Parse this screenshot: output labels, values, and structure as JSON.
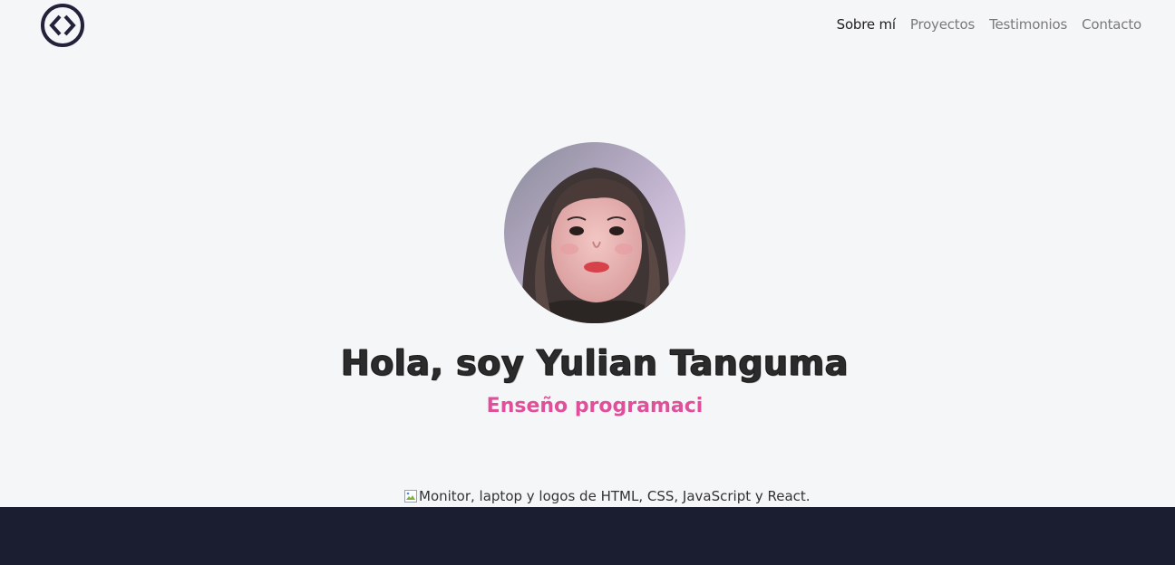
{
  "header": {
    "logo_icon": "code-brackets-icon",
    "nav": [
      {
        "label": "Sobre mí",
        "active": true
      },
      {
        "label": "Proyectos",
        "active": false
      },
      {
        "label": "Testimonios",
        "active": false
      },
      {
        "label": "Contacto",
        "active": false
      }
    ]
  },
  "hero": {
    "title": "Hola, soy Yulian Tanguma",
    "subtitle": "Enseño programaci",
    "broken_image_alt": "Monitor, laptop y logos de HTML, CSS, JavaScript y React."
  },
  "colors": {
    "background": "#f5f6f8",
    "accent_pink": "#e0509a",
    "footer": "#1b1d31",
    "logo": "#23223a"
  }
}
